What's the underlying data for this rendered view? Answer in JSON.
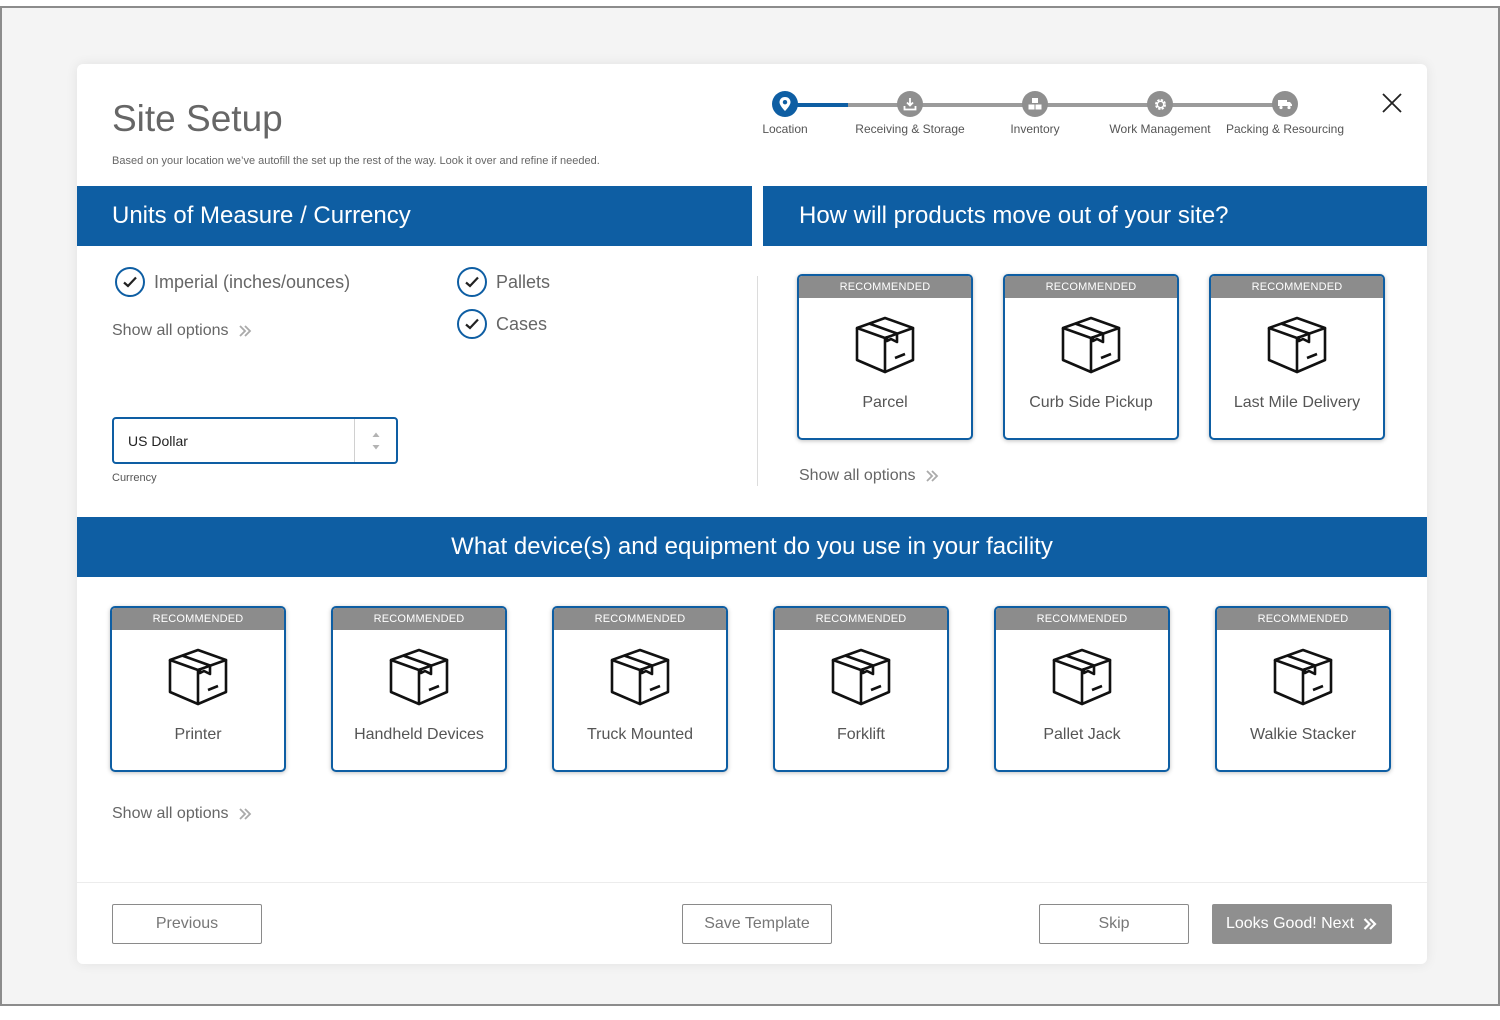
{
  "header": {
    "title": "Site Setup",
    "subtitle": "Based on your location we’ve autofill the set up the rest of the way. Look it over and refine if needed."
  },
  "stepper": {
    "steps": [
      {
        "label": "Location",
        "icon": "location-pin-icon",
        "active": true
      },
      {
        "label": "Receiving & Storage",
        "icon": "download-tray-icon",
        "active": false
      },
      {
        "label": "Inventory",
        "icon": "boxes-icon",
        "active": false
      },
      {
        "label": "Work Management",
        "icon": "gear-icon",
        "active": false
      },
      {
        "label": "Packing & Resourcing",
        "icon": "truck-icon",
        "active": false
      }
    ]
  },
  "units": {
    "heading": "Units of Measure / Currency",
    "measure_option": "Imperial (inches/ounces)",
    "packaging_options": [
      "Pallets",
      "Cases"
    ],
    "show_all": "Show all options",
    "currency": {
      "value": "US Dollar",
      "label": "Currency"
    }
  },
  "outbound": {
    "heading": "How will products move out of your site?",
    "cards": [
      {
        "badge": "RECOMMENDED",
        "name": "Parcel"
      },
      {
        "badge": "RECOMMENDED",
        "name": "Curb Side Pickup"
      },
      {
        "badge": "RECOMMENDED",
        "name": "Last Mile Delivery"
      }
    ],
    "show_all": "Show all options"
  },
  "devices": {
    "heading": "What device(s) and equipment do you use in your facility",
    "cards": [
      {
        "badge": "RECOMMENDED",
        "name": "Printer"
      },
      {
        "badge": "RECOMMENDED",
        "name": "Handheld Devices"
      },
      {
        "badge": "RECOMMENDED",
        "name": "Truck Mounted"
      },
      {
        "badge": "RECOMMENDED",
        "name": "Forklift"
      },
      {
        "badge": "RECOMMENDED",
        "name": "Pallet Jack"
      },
      {
        "badge": "RECOMMENDED",
        "name": "Walkie Stacker"
      }
    ],
    "show_all": "Show all options"
  },
  "footer": {
    "previous": "Previous",
    "save_template": "Save Template",
    "skip": "Skip",
    "next": "Looks Good! Next"
  },
  "colors": {
    "brand_blue": "#0e5ea3",
    "badge_gray": "#8c8c8c",
    "primary_button_gray": "#8f8f8f"
  }
}
